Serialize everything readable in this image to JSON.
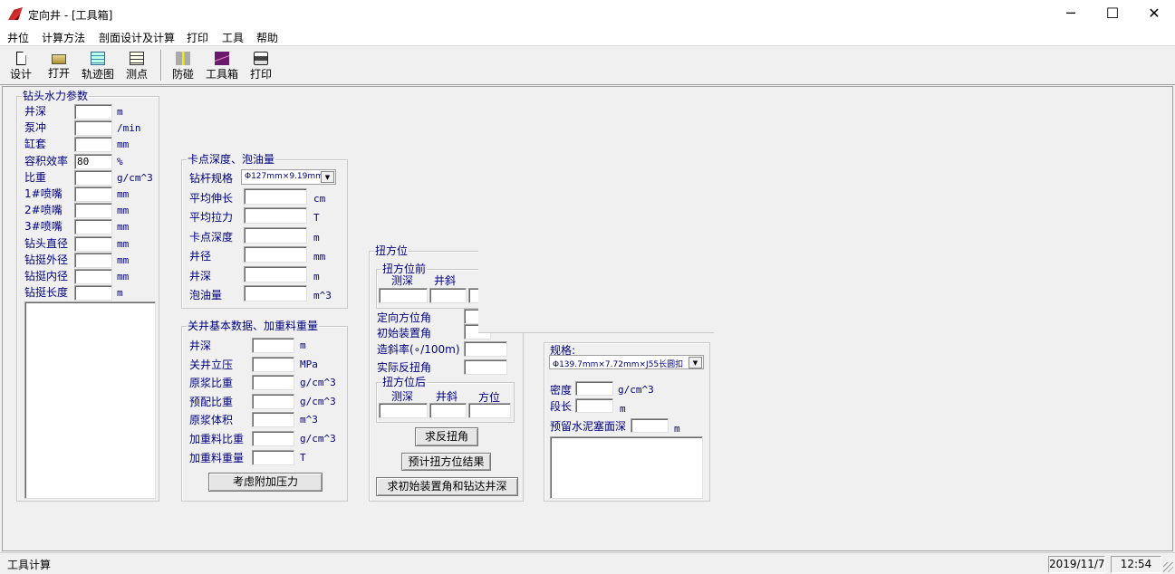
{
  "window": {
    "title": "定向井 - [工具箱]",
    "minimize": "─",
    "maximize": "☐",
    "close": "✕"
  },
  "menu": [
    "井位",
    "计算方法",
    "剖面设计及计算",
    "打印",
    "工具",
    "帮助"
  ],
  "toolbar": [
    {
      "label": "设计",
      "icon": "new-document-icon"
    },
    {
      "label": "打开",
      "icon": "open-folder-icon"
    },
    {
      "label": "轨迹图",
      "icon": "trajectory-chart-icon"
    },
    {
      "label": "测点",
      "icon": "survey-point-icon"
    },
    {
      "label": "防碰",
      "icon": "anti-collision-icon"
    },
    {
      "label": "工具箱",
      "icon": "toolbox-icon"
    },
    {
      "label": "打印",
      "icon": "printer-icon"
    }
  ],
  "hydraulics": {
    "title": "钻头水力参数",
    "rows": [
      {
        "label": "井深",
        "value": "",
        "unit": "m"
      },
      {
        "label": "泵冲",
        "value": "",
        "unit": "/min"
      },
      {
        "label": "缸套",
        "value": "",
        "unit": "mm"
      },
      {
        "label": "容积效率",
        "value": "80",
        "unit": "%"
      },
      {
        "label": "比重",
        "value": "",
        "unit": "g/cm^3"
      },
      {
        "label": "1#喷嘴",
        "value": "",
        "unit": "mm"
      },
      {
        "label": "2#喷嘴",
        "value": "",
        "unit": "mm"
      },
      {
        "label": "3#喷嘴",
        "value": "",
        "unit": "mm"
      },
      {
        "label": "钻头直径",
        "value": "",
        "unit": "mm"
      },
      {
        "label": "钻挺外径",
        "value": "",
        "unit": "mm"
      },
      {
        "label": "钻挺内径",
        "value": "",
        "unit": "mm"
      },
      {
        "label": "钻挺长度",
        "value": "",
        "unit": "m"
      }
    ],
    "output": ""
  },
  "stuck": {
    "title": "卡点深度、泡油量",
    "pipe_label": "钻杆规格",
    "pipe_value": "Φ127mm×9.19mm",
    "rows": [
      {
        "label": "平均伸长",
        "value": "",
        "unit": "cm"
      },
      {
        "label": "平均拉力",
        "value": "",
        "unit": "T"
      },
      {
        "label": "卡点深度",
        "value": "",
        "unit": "m"
      },
      {
        "label": "井径",
        "value": "",
        "unit": "mm"
      },
      {
        "label": "井深",
        "value": "",
        "unit": "m"
      },
      {
        "label": "泡油量",
        "value": "",
        "unit": "m^3"
      }
    ]
  },
  "shutin": {
    "title": "关井基本数据、加重料重量",
    "rows": [
      {
        "label": "井深",
        "value": "",
        "unit": "m"
      },
      {
        "label": "关井立压",
        "value": "",
        "unit": "MPa"
      },
      {
        "label": "原浆比重",
        "value": "",
        "unit": "g/cm^3"
      },
      {
        "label": "预配比重",
        "value": "",
        "unit": "g/cm^3"
      },
      {
        "label": "原浆体积",
        "value": "",
        "unit": "m^3"
      },
      {
        "label": "加重料比重",
        "value": "",
        "unit": "g/cm^3"
      },
      {
        "label": "加重料重量",
        "value": "",
        "unit": "T"
      }
    ],
    "button": "考虑附加压力"
  },
  "toolface": {
    "title": "扭方位",
    "before_title": "扭方位前",
    "before_headers": [
      "测深",
      "井斜"
    ],
    "orient_label": "定向方位角",
    "initial_label": "初始装置角",
    "build_label": "造斜率(∘/100m)",
    "reactive_label": "实际反扭角",
    "after_title": "扭方位后",
    "after_headers": [
      "测深",
      "井斜",
      "方位"
    ],
    "buttons": [
      "求反扭角",
      "预计扭方位结果",
      "求初始装置角和钻达井深"
    ]
  },
  "cement": {
    "spec_label": "规格:",
    "spec_value": "Φ139.7mm×7.72mm×J55长圆扣",
    "density_label": "密度",
    "density_unit": "g/cm^3",
    "length_label": "段长",
    "length_unit": "m",
    "plug_label": "预留水泥塞面深",
    "plug_unit": "m",
    "output": ""
  },
  "status": {
    "text": "工具计算",
    "date": "2019/11/7",
    "time": "12:54"
  }
}
